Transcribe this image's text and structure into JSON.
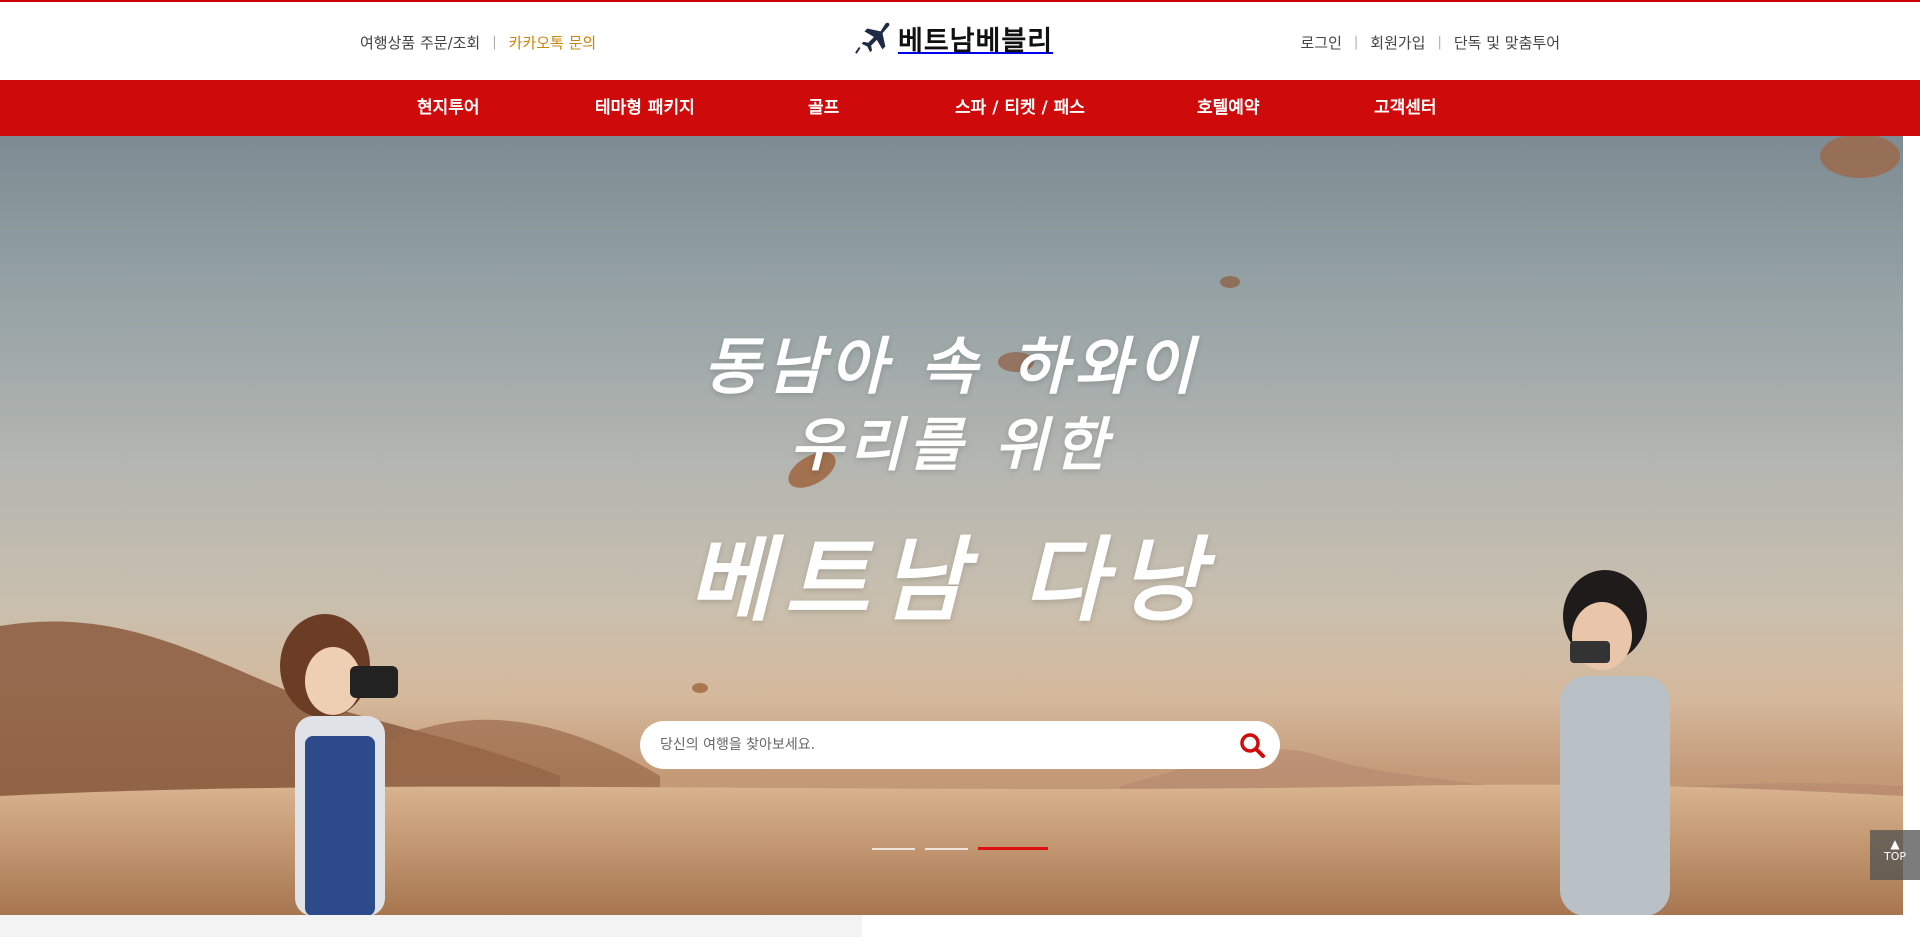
{
  "header": {
    "util_left": {
      "order_lookup": "여행상품 주문/조회",
      "kakao_inquiry": "카카오톡 문의"
    },
    "logo_text": "베트남베블리",
    "util_right": {
      "login": "로그인",
      "signup": "회원가입",
      "custom_tour": "단독 및 맞춤투어"
    }
  },
  "nav": {
    "items": [
      {
        "label": "현지투어"
      },
      {
        "label": "테마형 패키지"
      },
      {
        "label": "골프"
      },
      {
        "label": "스파 / 티켓 / 패스"
      },
      {
        "label": "호텔예약"
      },
      {
        "label": "고객센터"
      }
    ]
  },
  "hero": {
    "line1": "동남아 속 하와이",
    "line2": "우리를 위한",
    "line3": "베트남 다낭",
    "search_placeholder": "당신의 여행을 찾아보세요.",
    "slides_total": 3,
    "active_slide": 3
  },
  "top_button": {
    "label": "TOP",
    "arrow": "▲"
  },
  "colors": {
    "brand_red": "#cf0a0a",
    "kakao_orange": "#c8860a"
  },
  "icons": {
    "logo": "airplane-icon",
    "search": "search-icon",
    "top": "arrow-up-icon"
  }
}
